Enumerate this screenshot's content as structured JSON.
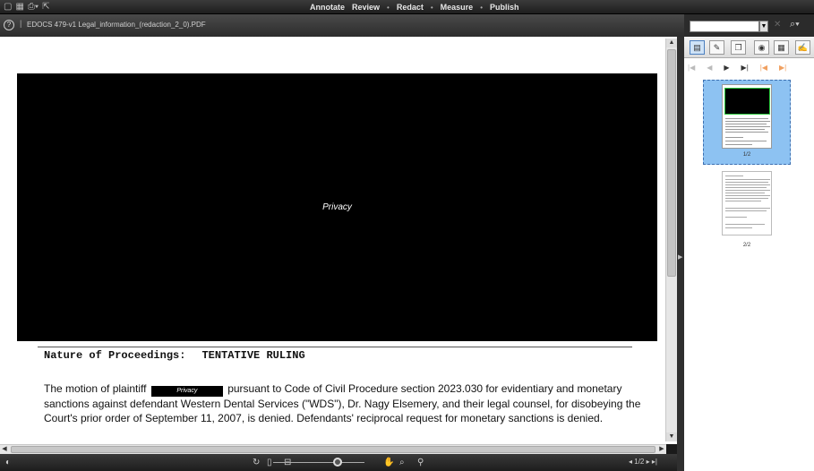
{
  "topbar": {
    "icons": [
      "new-doc-icon",
      "grid-icon",
      "print-icon",
      "pointer-icon"
    ],
    "menus": [
      "Annotate",
      "Review",
      "Redact",
      "Measure",
      "Publish"
    ]
  },
  "document": {
    "title": "EDOCS 479-v1 Legal_information_(redaction_2_0).PDF",
    "redaction_label": "Privacy",
    "inline_redaction_label": "Privacy",
    "proceedings_label": "Nature of Proceedings:",
    "proceedings_value": "TENTATIVE RULING",
    "body_before_redaction": "The motion of plaintiff",
    "body_after_redaction": "pursuant to Code of Civil Procedure section 2023.030 for evidentiary and monetary sanctions against defendant Western Dental Services (\"WDS\"), Dr. Nagy Elsemery, and their legal counsel, for disobeying the Court's prior order of September 11, 2007, is denied.  Defendants' reciprocal request for monetary sanctions is denied."
  },
  "search": {
    "value": ""
  },
  "thumbnails": {
    "pages": [
      {
        "label": "1/2",
        "selected": true
      },
      {
        "label": "2/2",
        "selected": false
      }
    ]
  },
  "bottombar": {
    "page_indicator": "1/2"
  },
  "colors": {
    "selection_fill": "#8dc2f2",
    "redaction": "#000000",
    "thumb_highlight": "#2ecc40"
  }
}
